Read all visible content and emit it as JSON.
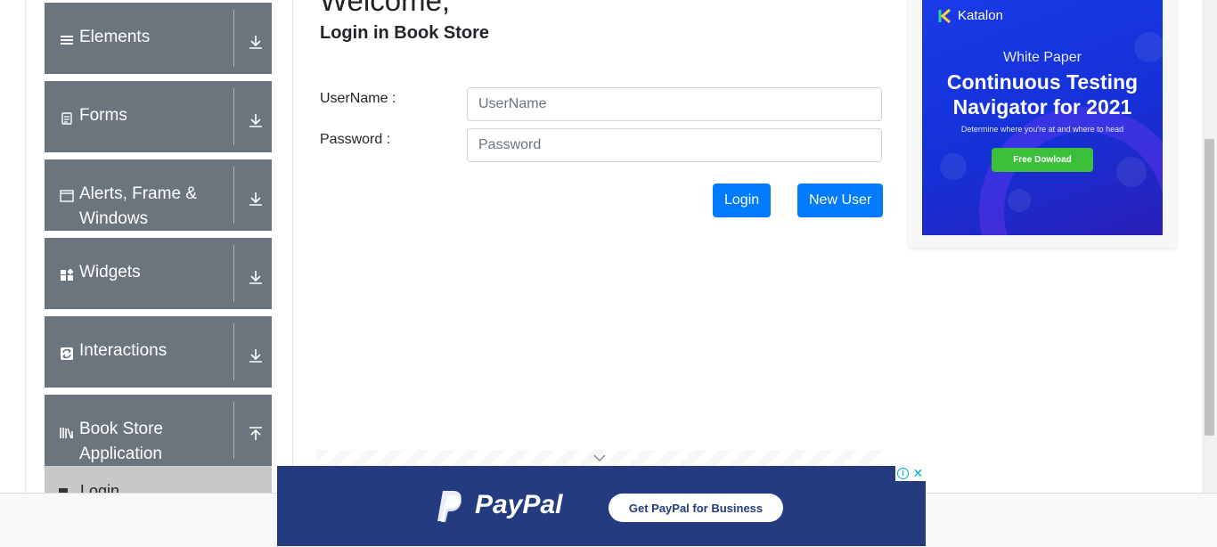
{
  "sidebar": {
    "groups": [
      {
        "label": "Elements",
        "icon": "hamburger-icon",
        "toggle": "expand"
      },
      {
        "label": "Forms",
        "icon": "document-icon",
        "toggle": "expand"
      },
      {
        "label": "Alerts, Frame & Windows",
        "icon": "window-icon",
        "toggle": "expand"
      },
      {
        "label": "Widgets",
        "icon": "widgets-icon",
        "toggle": "expand"
      },
      {
        "label": "Interactions",
        "icon": "interactions-icon",
        "toggle": "expand"
      },
      {
        "label": "Book Store Application",
        "icon": "books-icon",
        "toggle": "collapse"
      }
    ],
    "active_item": {
      "label": "Login",
      "icon": "login-icon"
    }
  },
  "main": {
    "title": "Welcome,",
    "subtitle": "Login in Book Store",
    "username": {
      "label": "UserName :",
      "placeholder": "UserName",
      "value": ""
    },
    "password": {
      "label": "Password :",
      "placeholder": "Password",
      "value": ""
    },
    "login_button": "Login",
    "new_user_button": "New User"
  },
  "side_ad": {
    "brand": "Katalon",
    "kicker": "White Paper",
    "headline_line1": "Continuous Testing",
    "headline_line2": "Navigator for 2021",
    "tagline": "Determine where you're at and where to head",
    "cta": "Free Dowload"
  },
  "bottom_ad": {
    "brand": "PayPal",
    "cta": "Get PayPal for Business"
  },
  "colors": {
    "sidebar_group": "#6c757d",
    "primary_button": "#007bff",
    "katalon_bg": "#1530d6",
    "paypal_bg": "#253b80",
    "cta_green": "#3cc03c"
  }
}
